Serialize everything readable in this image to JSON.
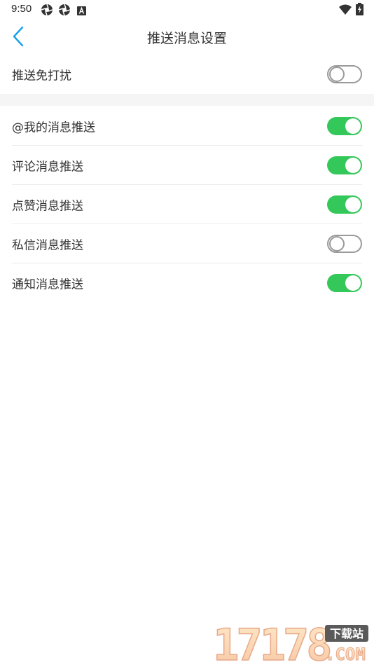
{
  "status_bar": {
    "time": "9:50",
    "left_icons": [
      "aperture-icon",
      "aperture-icon",
      "font-a-icon"
    ],
    "right_icons": [
      "wifi-icon",
      "battery-icon"
    ]
  },
  "header": {
    "title": "推送消息设置",
    "back_icon": "chevron-left-icon",
    "back_color": "#1aa0e6"
  },
  "settings": {
    "do_not_disturb": {
      "label": "推送免打扰",
      "enabled": false
    },
    "items": [
      {
        "label": "@我的消息推送",
        "enabled": true
      },
      {
        "label": "评论消息推送",
        "enabled": true
      },
      {
        "label": "点赞消息推送",
        "enabled": true
      },
      {
        "label": "私信消息推送",
        "enabled": false
      },
      {
        "label": "通知消息推送",
        "enabled": true
      }
    ]
  },
  "colors": {
    "toggle_on": "#34c759",
    "toggle_off_border": "#9a9a9a",
    "section_gap": "#f5f5f5"
  },
  "watermark": {
    "logo_text": "17178",
    "badge_text": "下载站",
    "suffix_text": ".COM"
  }
}
